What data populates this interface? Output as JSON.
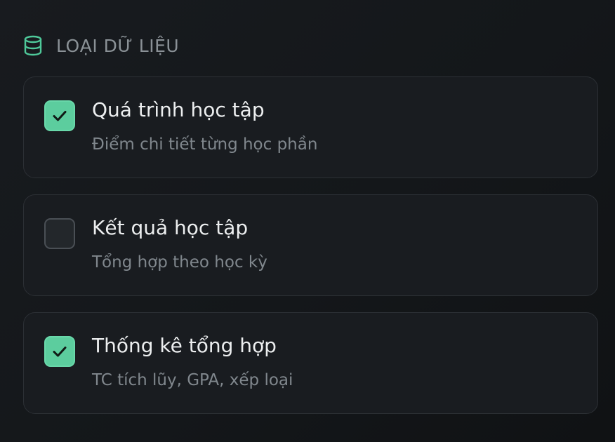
{
  "section": {
    "title": "LOẠI DỮ LIỆU",
    "icon": "database-icon",
    "icon_color": "#4fc99a"
  },
  "colors": {
    "accent": "#5ccd9e",
    "card_border": "#2c3035",
    "card_background": "#191c20"
  },
  "options": [
    {
      "label": "Quá trình học tập",
      "description": "Điểm chi tiết từng học phần",
      "checked": true
    },
    {
      "label": "Kết quả học tập",
      "description": "Tổng hợp theo học kỳ",
      "checked": false
    },
    {
      "label": "Thống kê tổng hợp",
      "description": "TC tích lũy, GPA, xếp loại",
      "checked": true
    }
  ]
}
